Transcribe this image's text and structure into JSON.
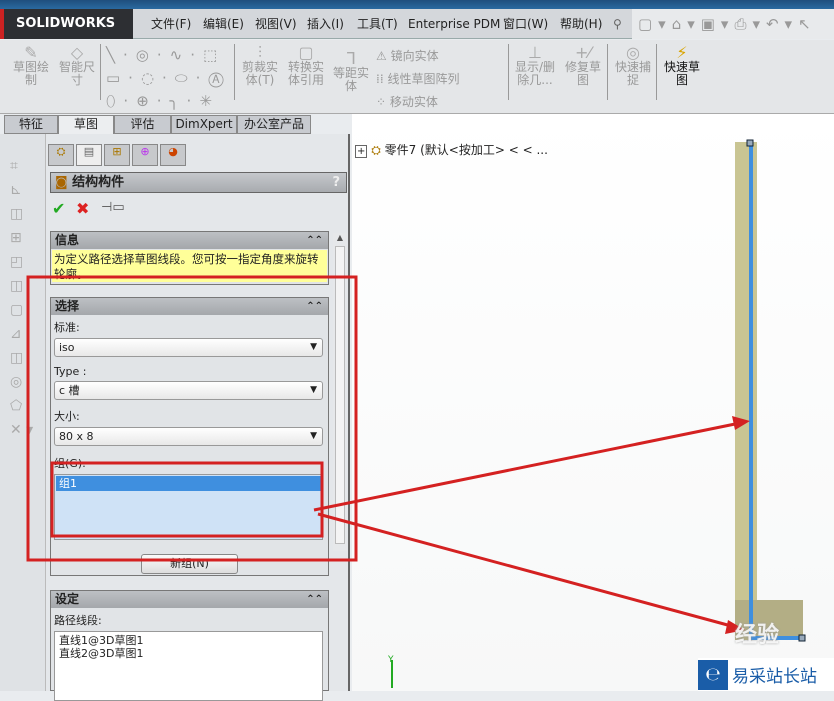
{
  "app": {
    "logo": "SOLIDWORKS"
  },
  "menu": [
    "文件(F)",
    "编辑(E)",
    "视图(V)",
    "插入(I)",
    "工具(T)",
    "Enterprise PDM",
    "窗口(W)",
    "帮助(H)"
  ],
  "toolbar": {
    "sketch": "草图绘制",
    "smart_dim": "智能尺寸",
    "trim": "剪裁实体(T)",
    "convert": "转换实体引用",
    "offset": "等距实体",
    "mirror": "镜向实体",
    "linear_pattern": "线性草图阵列",
    "move": "移动实体",
    "show_delete": "显示/删除几...",
    "repair": "修复草图",
    "quick_snap": "快速捕捉",
    "rapid_sketch": "快速草图"
  },
  "tabs": [
    "特征",
    "草图",
    "评估",
    "DimXpert",
    "办公室产品"
  ],
  "active_tab": "草图",
  "property_manager": {
    "title": "结构构件",
    "help": "?",
    "info": {
      "header": "信息",
      "text": "为定义路径选择草图线段。您可按一指定角度来旋转轮廓。"
    },
    "selection": {
      "header": "选择",
      "standard_label": "标准:",
      "standard_value": "iso",
      "type_label": "Type :",
      "type_value": "c 槽",
      "size_label": "大小:",
      "size_value": "80 x 8",
      "group_label": "组(G):",
      "groups": [
        "组1"
      ],
      "new_group": "新组(N)"
    },
    "settings": {
      "header": "设定",
      "path_label": "路径线段:",
      "paths": [
        "直线1@3D草图1",
        "直线2@3D草图1"
      ]
    }
  },
  "tree": {
    "root": "零件7 (默认<按加工> < < ..."
  },
  "watermark": {
    "text1": "经验",
    "text2": "易采站长站"
  },
  "colors": {
    "annotation": "#d42121",
    "selection": "#3f8fdf",
    "beam": "#c9c593"
  }
}
